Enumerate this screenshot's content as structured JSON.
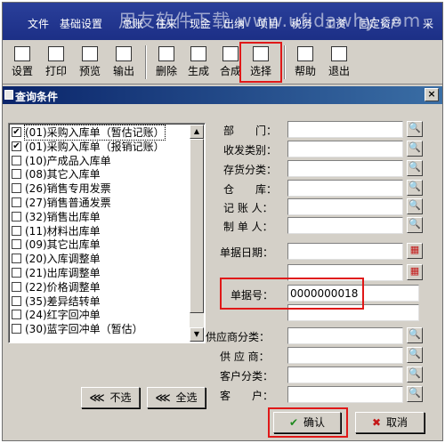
{
  "menubar": {
    "items": [
      "文件",
      "基础设置",
      "总账",
      "往来",
      "现金",
      "出纳",
      "项目",
      "税务",
      "工资",
      "固定资产",
      "采"
    ],
    "watermark": "用友软件下载 www.ufidawhy.com"
  },
  "toolbar": {
    "buttons": [
      {
        "label": "设置",
        "icon": "settings-icon"
      },
      {
        "label": "打印",
        "icon": "printer-icon"
      },
      {
        "label": "预览",
        "icon": "preview-icon"
      },
      {
        "label": "输出",
        "icon": "export-icon"
      },
      {
        "label": "删除",
        "icon": "delete-icon"
      },
      {
        "label": "生成",
        "icon": "generate-icon"
      },
      {
        "label": "合成",
        "icon": "merge-icon"
      },
      {
        "label": "选择",
        "icon": "binoculars-icon"
      },
      {
        "label": "帮助",
        "icon": "help-icon"
      },
      {
        "label": "退出",
        "icon": "exit-icon"
      }
    ]
  },
  "dialog": {
    "title": "查询条件",
    "close_label": "×"
  },
  "list": {
    "items": [
      {
        "label": "(01)采购入库单（暂估记账）",
        "checked": true
      },
      {
        "label": "(01)采购入库单（报销记账）",
        "checked": true
      },
      {
        "label": "(10)产成品入库单",
        "checked": false
      },
      {
        "label": "(08)其它入库单",
        "checked": false
      },
      {
        "label": "(26)销售专用发票",
        "checked": false
      },
      {
        "label": "(27)销售普通发票",
        "checked": false
      },
      {
        "label": "(32)销售出库单",
        "checked": false
      },
      {
        "label": "(11)材料出库单",
        "checked": false
      },
      {
        "label": "(09)其它出库单",
        "checked": false
      },
      {
        "label": "(20)入库调整单",
        "checked": false
      },
      {
        "label": "(21)出库调整单",
        "checked": false
      },
      {
        "label": "(22)价格调整单",
        "checked": false
      },
      {
        "label": "(35)差异结转单",
        "checked": false
      },
      {
        "label": "(24)红字回冲单",
        "checked": false
      },
      {
        "label": "(30)蓝字回冲单（暂估）",
        "checked": false
      }
    ],
    "deselect_label": "不选",
    "select_all_label": "全选"
  },
  "form": {
    "department_label": "部　　门：",
    "receive_type_label": "收发类别：",
    "inventory_class_label": "存货分类：",
    "warehouse_label": "仓　　库：",
    "bookkeeper_label": "记 账 人：",
    "maker_label": "制 单 人：",
    "doc_date_label": "单据日期：",
    "doc_no_label": "单据号：",
    "doc_no_value": "0000000018",
    "supplier_class_label": "供应商分类：",
    "supplier_label": "供 应 商：",
    "customer_class_label": "客户分类：",
    "customer_label": "客　　户："
  },
  "actions": {
    "confirm_label": "确认",
    "cancel_label": "取消"
  },
  "colors": {
    "highlight": "#e01818",
    "menubar": "#1c2f86",
    "title": "#0a246a"
  }
}
